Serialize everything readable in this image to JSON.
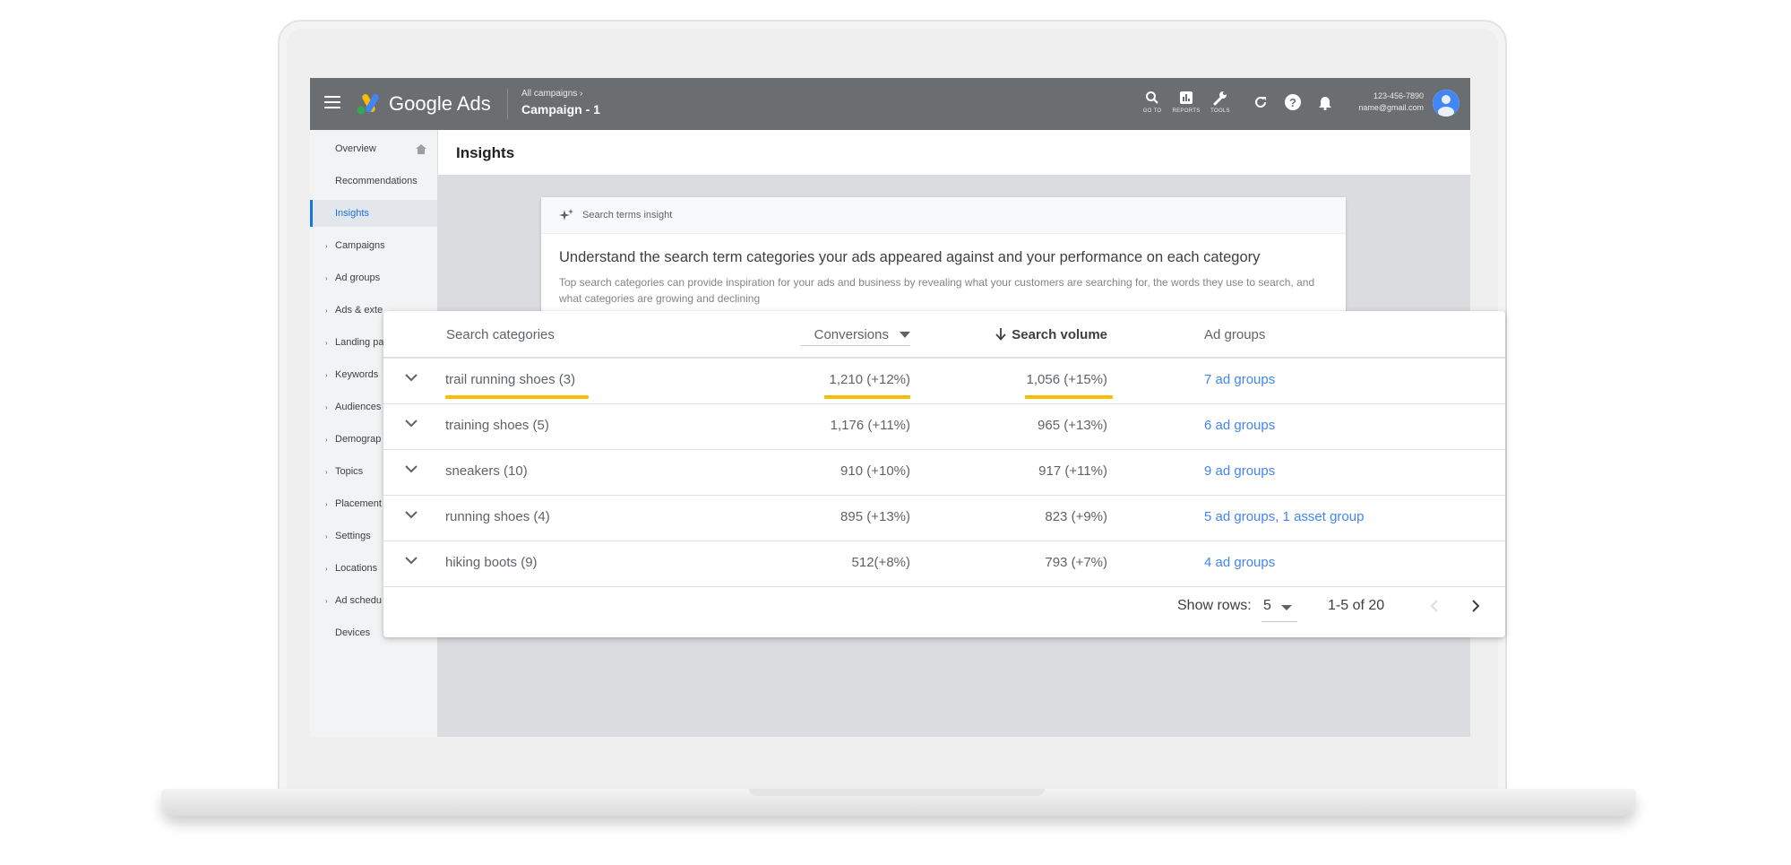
{
  "app": {
    "product_name": "Google Ads",
    "breadcrumb_parent": "All campaigns",
    "breadcrumb_current": "Campaign - 1"
  },
  "toolbar": {
    "goto_label": "GO TO",
    "reports_label": "REPORTS",
    "tools_label": "TOOLS",
    "account_id": "123-456-7890",
    "account_email": "name@gmail.com"
  },
  "sidebar": {
    "items": [
      {
        "label": "Overview",
        "expandable": false
      },
      {
        "label": "Recommendations",
        "expandable": false
      },
      {
        "label": "Insights",
        "expandable": false,
        "active": true
      },
      {
        "label": "Campaigns",
        "expandable": true
      },
      {
        "label": "Ad groups",
        "expandable": true
      },
      {
        "label": "Ads & exte",
        "expandable": true
      },
      {
        "label": "Landing pa",
        "expandable": true
      },
      {
        "label": "Keywords",
        "expandable": true
      },
      {
        "label": "Audiences",
        "expandable": true
      },
      {
        "label": "Demograp",
        "expandable": true
      },
      {
        "label": "Topics",
        "expandable": true
      },
      {
        "label": "Placement",
        "expandable": true
      },
      {
        "label": "Settings",
        "expandable": true
      },
      {
        "label": "Locations",
        "expandable": true
      },
      {
        "label": "Ad schedu",
        "expandable": true
      },
      {
        "label": "Devices",
        "expandable": false
      }
    ]
  },
  "page": {
    "title": "Insights"
  },
  "insight_card": {
    "tag": "Search terms insight",
    "headline": "Understand the search term categories your ads appeared against and your performance on each category",
    "description": "Top search categories can provide inspiration for your ads and business by revealing what your customers are searching for, the words they use to search, and what categories are growing and declining"
  },
  "table": {
    "headers": {
      "category": "Search categories",
      "conversions": "Conversions",
      "search_volume": "Search volume",
      "ad_groups": "Ad groups"
    },
    "rows": [
      {
        "category": "trail running shoes (3)",
        "conversions": "1,210 (+12%)",
        "search_volume": "1,056 (+15%)",
        "ad_groups": "7 ad groups",
        "highlighted": true
      },
      {
        "category": "training shoes (5)",
        "conversions": "1,176 (+11%)",
        "search_volume": "965 (+13%)",
        "ad_groups": "6 ad groups"
      },
      {
        "category": "sneakers (10)",
        "conversions": "910 (+10%)",
        "search_volume": "917 (+11%)",
        "ad_groups": "9 ad groups"
      },
      {
        "category": "running shoes (4)",
        "conversions": "895 (+13%)",
        "search_volume": "823 (+9%)",
        "ad_groups": "5 ad groups, 1 asset group"
      },
      {
        "category": "hiking boots (9)",
        "conversions": "512(+8%)",
        "search_volume": "793 (+7%)",
        "ad_groups": "4 ad groups"
      }
    ],
    "footer": {
      "show_rows_label": "Show rows:",
      "rows_value": "5",
      "range_text": "1-5 of 20"
    }
  },
  "colors": {
    "topbar": "#6b6e70",
    "accent_blue": "#1a73e8",
    "link_blue": "#4285f4",
    "highlight_yellow": "#fbbc04"
  },
  "icons": [
    "menu-icon",
    "google-ads-logo",
    "search-icon",
    "reports-icon",
    "tools-icon",
    "refresh-icon",
    "help-icon",
    "bell-icon",
    "avatar-icon",
    "home-icon",
    "sparkle-icon",
    "chevron-down-icon",
    "arrow-down-icon",
    "chevron-left-icon",
    "chevron-right-icon"
  ]
}
